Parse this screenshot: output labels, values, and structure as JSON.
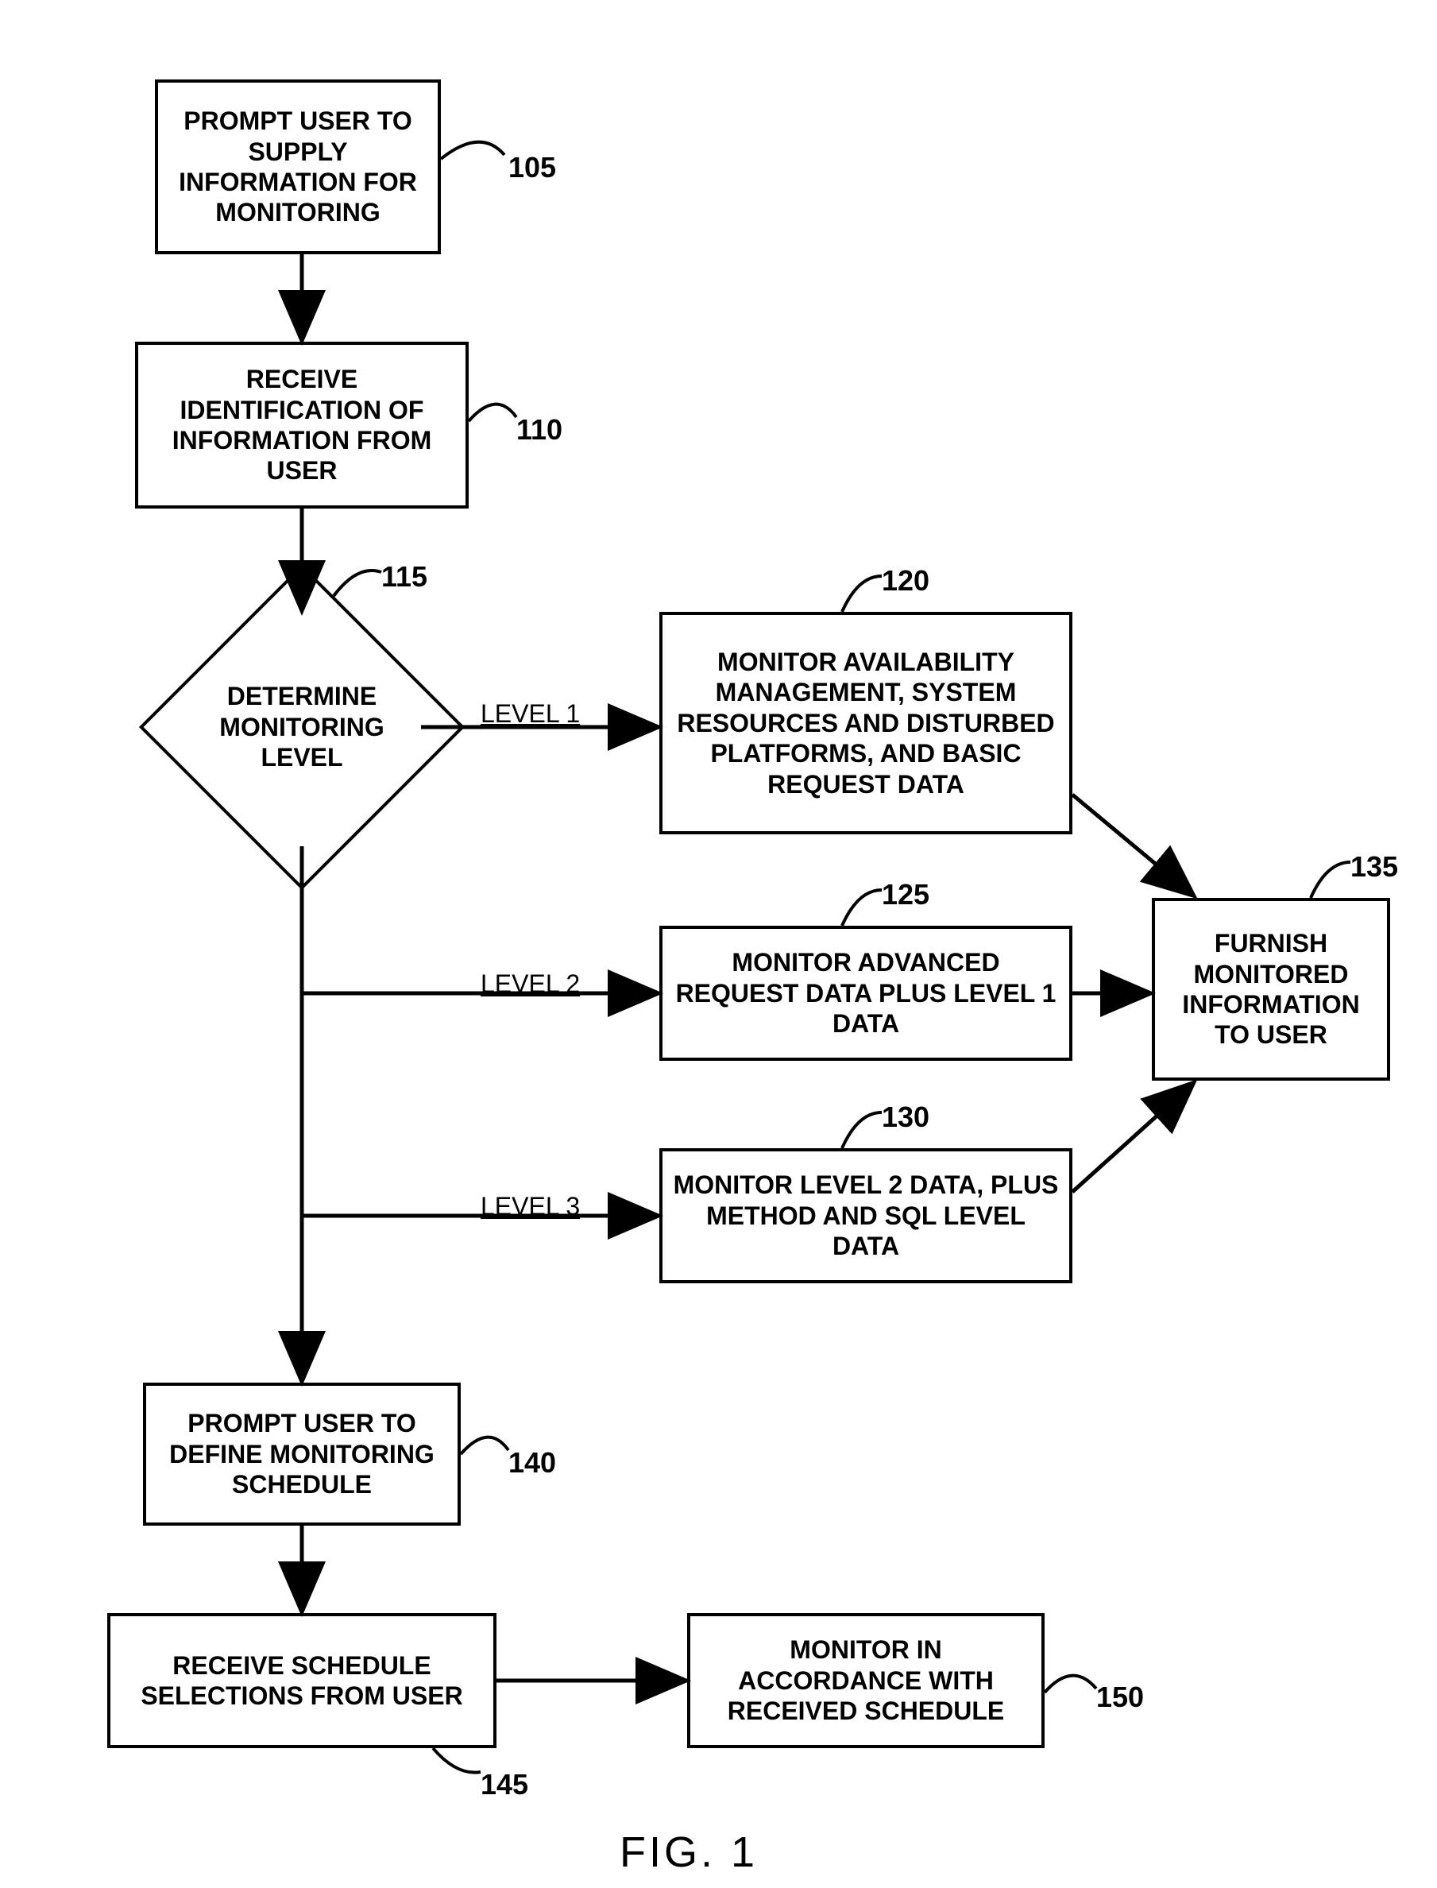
{
  "figure_label": "FIG. 1",
  "boxes": {
    "b105": {
      "text": "PROMPT USER TO SUPPLY INFORMATION FOR MONITORING",
      "ref": "105"
    },
    "b110": {
      "text": "RECEIVE IDENTIFICATION OF INFORMATION FROM USER",
      "ref": "110"
    },
    "b115": {
      "text": "DETERMINE MONITORING LEVEL",
      "ref": "115"
    },
    "b120": {
      "text": "MONITOR AVAILABILITY MANAGEMENT, SYSTEM RESOURCES AND DISTURBED PLATFORMS, AND BASIC REQUEST DATA",
      "ref": "120"
    },
    "b125": {
      "text": "MONITOR ADVANCED REQUEST DATA PLUS LEVEL 1 DATA",
      "ref": "125"
    },
    "b130": {
      "text": "MONITOR LEVEL 2 DATA, PLUS METHOD AND SQL LEVEL DATA",
      "ref": "130"
    },
    "b135": {
      "text": "FURNISH MONITORED INFORMATION TO USER",
      "ref": "135"
    },
    "b140": {
      "text": "PROMPT USER TO DEFINE MONITORING SCHEDULE",
      "ref": "140"
    },
    "b145": {
      "text": "RECEIVE SCHEDULE SELECTIONS FROM USER",
      "ref": "145"
    },
    "b150": {
      "text": "MONITOR IN ACCORDANCE WITH RECEIVED SCHEDULE",
      "ref": "150"
    }
  },
  "edge_labels": {
    "l1": "LEVEL 1",
    "l2": "LEVEL 2",
    "l3": "LEVEL 3"
  }
}
